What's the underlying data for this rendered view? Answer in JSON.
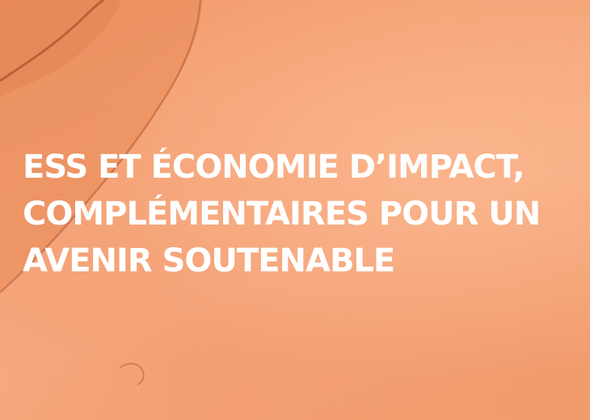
{
  "background": {
    "color": "#f5a57a",
    "texture": "watercolor-paper"
  },
  "headline": {
    "lines": [
      "ESS ET ÉCONOMIE D’IMPACT,",
      "COMPLÉMENTAIRES POUR UN",
      "AVENIR SOUTENABLE"
    ],
    "color": "#ffffff"
  }
}
